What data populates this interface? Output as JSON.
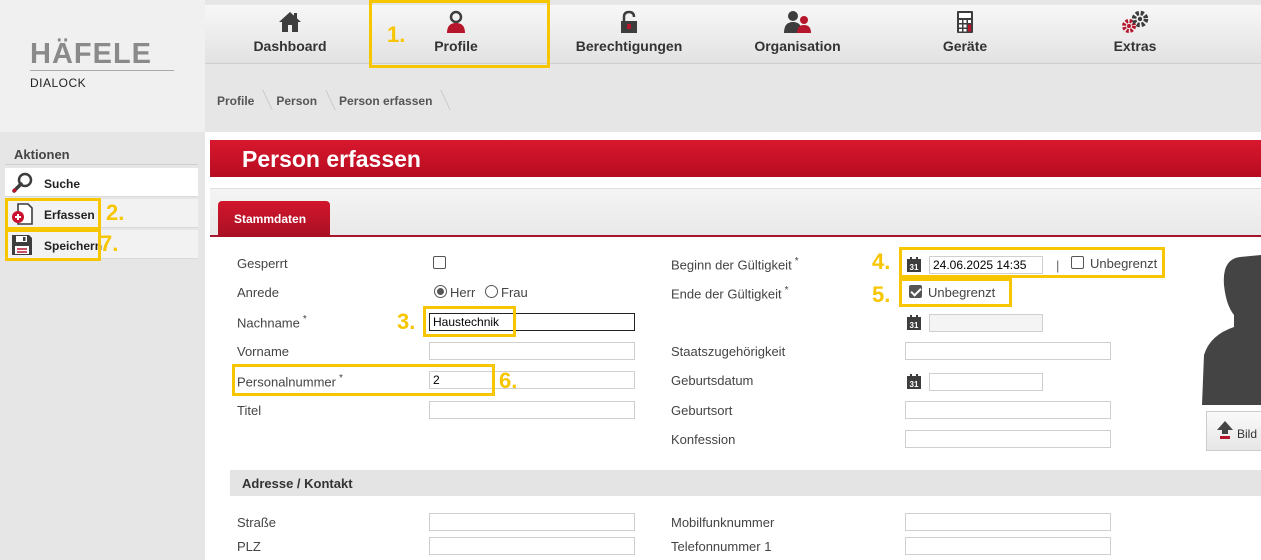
{
  "logo": {
    "brand": "HÄFELE",
    "product": "DIALOCK"
  },
  "nav": [
    {
      "label": "Dashboard",
      "icon": "home-icon"
    },
    {
      "label": "Profile",
      "icon": "person-icon"
    },
    {
      "label": "Berechtigungen",
      "icon": "padlock-icon"
    },
    {
      "label": "Organisation",
      "icon": "group-icon"
    },
    {
      "label": "Geräte",
      "icon": "calculator-icon"
    },
    {
      "label": "Extras",
      "icon": "gears-icon"
    }
  ],
  "breadcrumb": [
    "Profile",
    "Person",
    "Person erfassen"
  ],
  "sidebar": {
    "title": "Aktionen",
    "items": [
      {
        "label": "Suche",
        "icon": "magnifier-icon"
      },
      {
        "label": "Erfassen",
        "icon": "add-document-icon"
      },
      {
        "label": "Speichern",
        "icon": "floppy-disk-icon"
      }
    ]
  },
  "page": {
    "title": "Person erfassen",
    "tab": "Stammdaten"
  },
  "form": {
    "gesperrt": {
      "label": "Gesperrt",
      "checked": false
    },
    "anrede": {
      "label": "Anrede",
      "options": [
        "Herr",
        "Frau"
      ],
      "selected": "Herr"
    },
    "nachname": {
      "label": "Nachname",
      "value": "Haustechnik",
      "required": "*"
    },
    "vorname": {
      "label": "Vorname",
      "value": ""
    },
    "personalnummer": {
      "label": "Personalnummer",
      "value": "2",
      "required": "*"
    },
    "titel": {
      "label": "Titel",
      "value": ""
    },
    "beginn": {
      "label": "Beginn der Gültigkeit",
      "required": "*",
      "value": "24.06.2025 14:35",
      "separator": "|",
      "unbegrenzt": "Unbegrenzt",
      "unbegrenzt_checked": false
    },
    "ende": {
      "label": "Ende der Gültigkeit",
      "required": "*",
      "unbegrenzt": "Unbegrenzt",
      "unbegrenzt_checked": true,
      "value": ""
    },
    "staatszugehoerigkeit": {
      "label": "Staatszugehörigkeit",
      "value": ""
    },
    "geburtsdatum": {
      "label": "Geburtsdatum",
      "value": ""
    },
    "geburtsort": {
      "label": "Geburtsort",
      "value": ""
    },
    "konfession": {
      "label": "Konfession",
      "value": ""
    }
  },
  "address": {
    "title": "Adresse / Kontakt",
    "strasse": {
      "label": "Straße",
      "value": ""
    },
    "plz": {
      "label": "PLZ",
      "value": ""
    },
    "mobil": {
      "label": "Mobilfunknummer",
      "value": ""
    },
    "telefon": {
      "label": "Telefonnummer 1",
      "value": ""
    }
  },
  "photo": {
    "button_label": "Bild"
  },
  "annotations": [
    "1.",
    "2.",
    "3.",
    "4.",
    "5.",
    "6.",
    "7."
  ],
  "colors": {
    "brand_red": "#c8102e",
    "highlight": "#f7c600"
  }
}
